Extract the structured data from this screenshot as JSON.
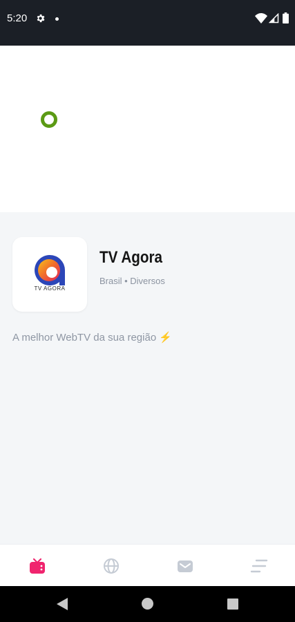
{
  "status_bar": {
    "time": "5:20",
    "icons": [
      "gear-icon",
      "notification-dot",
      "wifi-icon",
      "signal-icon",
      "battery-icon"
    ]
  },
  "player": {
    "loading_indicator_color": "#5b9a14"
  },
  "channel": {
    "logo_text": "TV AGORA",
    "name": "TV Agora",
    "meta": "Brasil • Diversos",
    "description": "A melhor WebTV da sua região ⚡"
  },
  "bottom_nav": {
    "items": [
      {
        "icon": "tv-icon",
        "active": true,
        "color": "#f0246e"
      },
      {
        "icon": "globe-icon",
        "active": false,
        "color": "#c5cbd4"
      },
      {
        "icon": "mail-icon",
        "active": false,
        "color": "#c5cbd4"
      },
      {
        "icon": "menu-icon",
        "active": false,
        "color": "#c5cbd4"
      }
    ]
  },
  "system_nav": {
    "buttons": [
      "back",
      "home",
      "recents"
    ]
  }
}
